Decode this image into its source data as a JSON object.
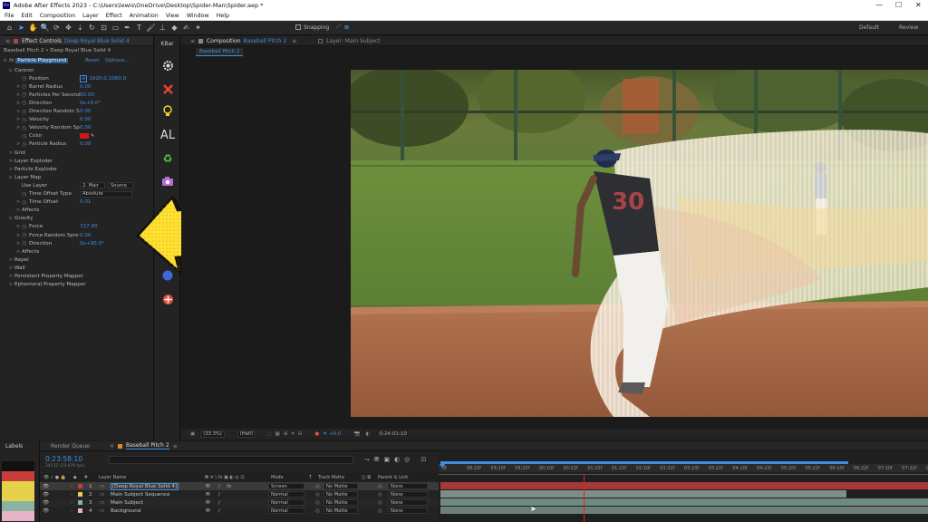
{
  "app": {
    "title": "Adobe After Effects 2023 - C:\\Users\\lewis\\OneDrive\\Desktop\\Spider-Man\\Spider.aep *",
    "icon_text": "Ae"
  },
  "menu": [
    "File",
    "Edit",
    "Composition",
    "Layer",
    "Effect",
    "Animation",
    "View",
    "Window",
    "Help"
  ],
  "toolbar": {
    "snapping": "Snapping",
    "workspaces": [
      "Default",
      "Review"
    ]
  },
  "effect_controls": {
    "tab": "Effect Controls",
    "tab_layer": "Deep Royal Blue Solid 4",
    "breadcrumb": "Baseball Pitch 2 • Deep Royal Blue Solid 4",
    "effect_name": "Particle Playground",
    "reset": "Reset",
    "options": "Options...",
    "rows": [
      {
        "indent": 1,
        "twirl": "v",
        "label": "Cannon",
        "value": ""
      },
      {
        "indent": 2,
        "twirl": "",
        "label": "Position",
        "value": "1920.0,1080.0",
        "stopwatch": true,
        "crosshair": true
      },
      {
        "indent": 2,
        "twirl": ">",
        "label": "Barrel Radius",
        "value": "0.00",
        "stopwatch": true
      },
      {
        "indent": 2,
        "twirl": ">",
        "label": "Particles Per Second",
        "value": "60.00",
        "stopwatch": true
      },
      {
        "indent": 2,
        "twirl": ">",
        "label": "Direction",
        "value": "0x+0.0°",
        "stopwatch": true
      },
      {
        "indent": 2,
        "twirl": ">",
        "label": "Direction Random S",
        "value": "0.00",
        "stopwatch": true
      },
      {
        "indent": 2,
        "twirl": ">",
        "label": "Velocity",
        "value": "0.00",
        "stopwatch": true
      },
      {
        "indent": 2,
        "twirl": ">",
        "label": "Velocity Random Sp",
        "value": "0.00",
        "stopwatch": true
      },
      {
        "indent": 2,
        "twirl": "",
        "label": "Color",
        "value": "",
        "stopwatch": true,
        "swatch": "#d01818"
      },
      {
        "indent": 2,
        "twirl": ">",
        "label": "Particle Radius",
        "value": "0.00",
        "stopwatch": true
      },
      {
        "indent": 1,
        "twirl": ">",
        "label": "Grid",
        "value": ""
      },
      {
        "indent": 1,
        "twirl": ">",
        "label": "Layer Exploder",
        "value": ""
      },
      {
        "indent": 1,
        "twirl": ">",
        "label": "Particle Exploder",
        "value": ""
      },
      {
        "indent": 1,
        "twirl": "v",
        "label": "Layer Map",
        "value": ""
      },
      {
        "indent": 2,
        "twirl": "",
        "label": "Use Layer",
        "value": "",
        "dropdowns": [
          "2. Mair",
          "Source"
        ]
      },
      {
        "indent": 2,
        "twirl": "",
        "label": "Time Offset Type",
        "value": "",
        "stopwatch": true,
        "dropdowns": [
          "Absolute"
        ]
      },
      {
        "indent": 2,
        "twirl": ">",
        "label": "Time Offset",
        "value": "0.01",
        "stopwatch": true
      },
      {
        "indent": 2,
        "twirl": ">",
        "label": "Affects",
        "value": ""
      },
      {
        "indent": 1,
        "twirl": "v",
        "label": "Gravity",
        "value": ""
      },
      {
        "indent": 2,
        "twirl": ">",
        "label": "Force",
        "value": "727.00",
        "stopwatch": true
      },
      {
        "indent": 2,
        "twirl": ">",
        "label": "Force Random Spre",
        "value": "0.00",
        "stopwatch": true
      },
      {
        "indent": 2,
        "twirl": ">",
        "label": "Direction",
        "value": "0x+90.0°",
        "stopwatch": true
      },
      {
        "indent": 2,
        "twirl": ">",
        "label": "Affects",
        "value": ""
      },
      {
        "indent": 1,
        "twirl": ">",
        "label": "Repel",
        "value": ""
      },
      {
        "indent": 1,
        "twirl": ">",
        "label": "Wall",
        "value": ""
      },
      {
        "indent": 1,
        "twirl": ">",
        "label": "Persistent Property Mapper",
        "value": ""
      },
      {
        "indent": 1,
        "twirl": ">",
        "label": "Ephemeral Property Mapper",
        "value": ""
      }
    ]
  },
  "kbar": {
    "title": "KBar",
    "icons": [
      "gear-icon",
      "crosshair-icon",
      "lightbulb-icon",
      "al-text-icon",
      "recycle-icon",
      "camera-icon",
      "blue-dot-icon",
      "red-move-icon"
    ],
    "al": "AL"
  },
  "composition": {
    "tab_label": "Composition",
    "tab_name": "Baseball Pitch 2",
    "layer_tab": "Layer: Main Subject",
    "sub_tab": "Baseball Pitch 2",
    "bottom": {
      "zoom": "(33.3%)",
      "resolution": "(Half)",
      "exposure": "+0.0",
      "timecode": "0:24:01:10"
    },
    "player_number": "30"
  },
  "timeline": {
    "labels_header": "Labels",
    "label_colors": [
      "#111111",
      "#c83c3c",
      "#e6d24a",
      "#e6d24a",
      "#8ab3a3",
      "#e6b4c8"
    ],
    "tabs": {
      "render_queue": "Render Queue",
      "comp": "Baseball Pitch 2"
    },
    "timecode": "0:23:58:10",
    "fps": "34532 (23.976 fps)",
    "columns": {
      "layer_name": "Layer Name",
      "mode": "Mode",
      "t": "T",
      "track_matte": "Track Matte",
      "parent": "Parent & Link",
      "num": "#"
    },
    "layers": [
      {
        "num": "1",
        "name": "[Deep Royal Blue Solid 4]",
        "label": "#c83c3c",
        "mode": "Screen",
        "matte": "No Matte",
        "parent": "None",
        "fx": true,
        "selected": true
      },
      {
        "num": "2",
        "name": "Main Subject Sequence",
        "label": "#e6d24a",
        "mode": "Normal",
        "matte": "No Matte",
        "parent": "None",
        "fx": false,
        "selected": false
      },
      {
        "num": "3",
        "name": "Main Subject",
        "label": "#8ab3a3",
        "mode": "Normal",
        "matte": "No Matte",
        "parent": "None",
        "fx": false,
        "selected": false
      },
      {
        "num": "4",
        "name": "Background",
        "label": "#e6b4c8",
        "mode": "Normal",
        "matte": "No Matte",
        "parent": "None",
        "fx": false,
        "selected": false
      }
    ],
    "ruler": [
      "0f",
      "58:22f",
      "59:10f",
      "59:22f",
      "00:10f",
      "00:22f",
      "01:10f",
      "01:22f",
      "02:10f",
      "02:22f",
      "03:10f",
      "03:22f",
      "04:10f",
      "04:22f",
      "05:10f",
      "05:22f",
      "06:10f",
      "06:22f",
      "07:10f",
      "07:22f",
      "08:1"
    ],
    "playhead_fraction": 0.297
  },
  "colors": {
    "accent": "#3d8ee0",
    "selection": "#2d5a8c",
    "arrow": "#ffe033"
  }
}
